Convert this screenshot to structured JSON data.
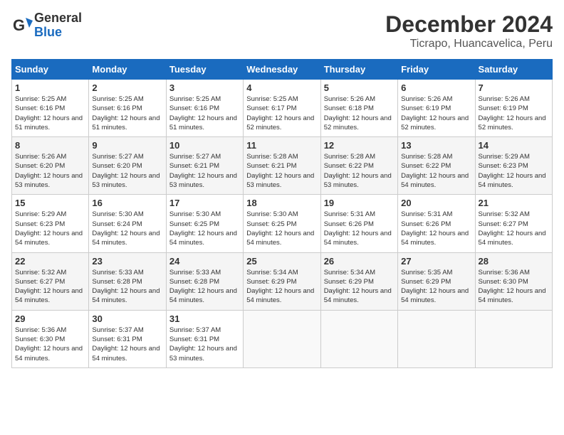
{
  "logo": {
    "general": "General",
    "blue": "Blue"
  },
  "title": {
    "month": "December 2024",
    "location": "Ticrapo, Huancavelica, Peru"
  },
  "weekdays": [
    "Sunday",
    "Monday",
    "Tuesday",
    "Wednesday",
    "Thursday",
    "Friday",
    "Saturday"
  ],
  "weeks": [
    [
      {
        "day": "1",
        "sunrise": "5:25 AM",
        "sunset": "6:16 PM",
        "daylight": "12 hours and 51 minutes."
      },
      {
        "day": "2",
        "sunrise": "5:25 AM",
        "sunset": "6:16 PM",
        "daylight": "12 hours and 51 minutes."
      },
      {
        "day": "3",
        "sunrise": "5:25 AM",
        "sunset": "6:16 PM",
        "daylight": "12 hours and 51 minutes."
      },
      {
        "day": "4",
        "sunrise": "5:25 AM",
        "sunset": "6:17 PM",
        "daylight": "12 hours and 52 minutes."
      },
      {
        "day": "5",
        "sunrise": "5:26 AM",
        "sunset": "6:18 PM",
        "daylight": "12 hours and 52 minutes."
      },
      {
        "day": "6",
        "sunrise": "5:26 AM",
        "sunset": "6:19 PM",
        "daylight": "12 hours and 52 minutes."
      },
      {
        "day": "7",
        "sunrise": "5:26 AM",
        "sunset": "6:19 PM",
        "daylight": "12 hours and 52 minutes."
      }
    ],
    [
      {
        "day": "8",
        "sunrise": "5:26 AM",
        "sunset": "6:20 PM",
        "daylight": "12 hours and 53 minutes."
      },
      {
        "day": "9",
        "sunrise": "5:27 AM",
        "sunset": "6:20 PM",
        "daylight": "12 hours and 53 minutes."
      },
      {
        "day": "10",
        "sunrise": "5:27 AM",
        "sunset": "6:21 PM",
        "daylight": "12 hours and 53 minutes."
      },
      {
        "day": "11",
        "sunrise": "5:28 AM",
        "sunset": "6:21 PM",
        "daylight": "12 hours and 53 minutes."
      },
      {
        "day": "12",
        "sunrise": "5:28 AM",
        "sunset": "6:22 PM",
        "daylight": "12 hours and 53 minutes."
      },
      {
        "day": "13",
        "sunrise": "5:28 AM",
        "sunset": "6:22 PM",
        "daylight": "12 hours and 54 minutes."
      },
      {
        "day": "14",
        "sunrise": "5:29 AM",
        "sunset": "6:23 PM",
        "daylight": "12 hours and 54 minutes."
      }
    ],
    [
      {
        "day": "15",
        "sunrise": "5:29 AM",
        "sunset": "6:23 PM",
        "daylight": "12 hours and 54 minutes."
      },
      {
        "day": "16",
        "sunrise": "5:30 AM",
        "sunset": "6:24 PM",
        "daylight": "12 hours and 54 minutes."
      },
      {
        "day": "17",
        "sunrise": "5:30 AM",
        "sunset": "6:25 PM",
        "daylight": "12 hours and 54 minutes."
      },
      {
        "day": "18",
        "sunrise": "5:30 AM",
        "sunset": "6:25 PM",
        "daylight": "12 hours and 54 minutes."
      },
      {
        "day": "19",
        "sunrise": "5:31 AM",
        "sunset": "6:26 PM",
        "daylight": "12 hours and 54 minutes."
      },
      {
        "day": "20",
        "sunrise": "5:31 AM",
        "sunset": "6:26 PM",
        "daylight": "12 hours and 54 minutes."
      },
      {
        "day": "21",
        "sunrise": "5:32 AM",
        "sunset": "6:27 PM",
        "daylight": "12 hours and 54 minutes."
      }
    ],
    [
      {
        "day": "22",
        "sunrise": "5:32 AM",
        "sunset": "6:27 PM",
        "daylight": "12 hours and 54 minutes."
      },
      {
        "day": "23",
        "sunrise": "5:33 AM",
        "sunset": "6:28 PM",
        "daylight": "12 hours and 54 minutes."
      },
      {
        "day": "24",
        "sunrise": "5:33 AM",
        "sunset": "6:28 PM",
        "daylight": "12 hours and 54 minutes."
      },
      {
        "day": "25",
        "sunrise": "5:34 AM",
        "sunset": "6:29 PM",
        "daylight": "12 hours and 54 minutes."
      },
      {
        "day": "26",
        "sunrise": "5:34 AM",
        "sunset": "6:29 PM",
        "daylight": "12 hours and 54 minutes."
      },
      {
        "day": "27",
        "sunrise": "5:35 AM",
        "sunset": "6:29 PM",
        "daylight": "12 hours and 54 minutes."
      },
      {
        "day": "28",
        "sunrise": "5:36 AM",
        "sunset": "6:30 PM",
        "daylight": "12 hours and 54 minutes."
      }
    ],
    [
      {
        "day": "29",
        "sunrise": "5:36 AM",
        "sunset": "6:30 PM",
        "daylight": "12 hours and 54 minutes."
      },
      {
        "day": "30",
        "sunrise": "5:37 AM",
        "sunset": "6:31 PM",
        "daylight": "12 hours and 54 minutes."
      },
      {
        "day": "31",
        "sunrise": "5:37 AM",
        "sunset": "6:31 PM",
        "daylight": "12 hours and 53 minutes."
      },
      null,
      null,
      null,
      null
    ]
  ]
}
